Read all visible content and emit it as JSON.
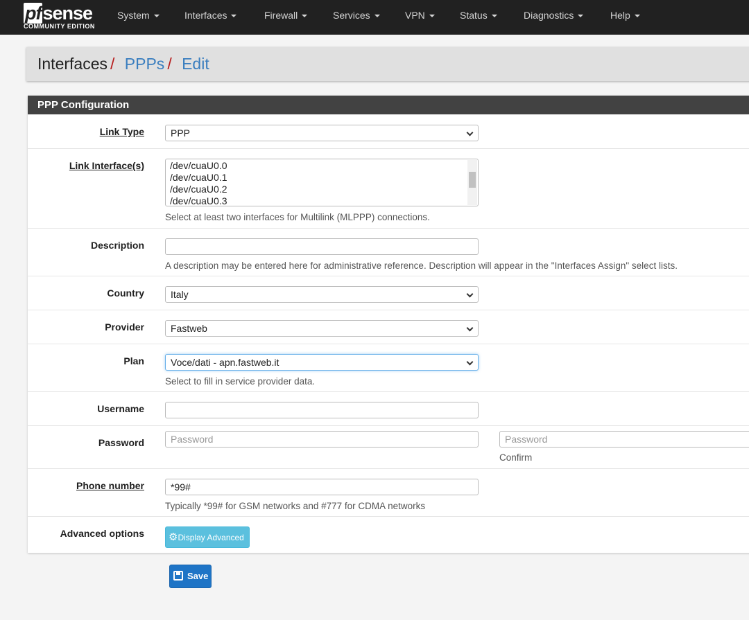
{
  "nav": {
    "logo_main": "pfsense",
    "logo_sub": "COMMUNITY EDITION",
    "items": [
      "System",
      "Interfaces",
      "Firewall",
      "Services",
      "VPN",
      "Status",
      "Diagnostics",
      "Help"
    ]
  },
  "breadcrumb": [
    "Interfaces",
    "PPPs",
    "Edit"
  ],
  "panel_title": "PPP Configuration",
  "form": {
    "link_type": {
      "label": "Link Type",
      "value": "PPP"
    },
    "link_interfaces": {
      "label": "Link Interface(s)",
      "options": [
        "/dev/cuaU0.0",
        "/dev/cuaU0.1",
        "/dev/cuaU0.2",
        "/dev/cuaU0.3"
      ],
      "help": "Select at least two interfaces for Multilink (MLPPP) connections."
    },
    "description": {
      "label": "Description",
      "value": "",
      "help": "A description may be entered here for administrative reference. Description will appear in the \"Interfaces Assign\" select lists."
    },
    "country": {
      "label": "Country",
      "value": "Italy"
    },
    "provider": {
      "label": "Provider",
      "value": "Fastweb"
    },
    "plan": {
      "label": "Plan",
      "value": "Voce/dati - apn.fastweb.it",
      "help": "Select to fill in service provider data."
    },
    "username": {
      "label": "Username",
      "value": ""
    },
    "password": {
      "label": "Password",
      "placeholder": "Password",
      "confirm_placeholder": "Password",
      "confirm_help": "Confirm"
    },
    "phone": {
      "label": "Phone number",
      "value": "*99#",
      "help": "Typically *99# for GSM networks and #777 for CDMA networks"
    },
    "advanced": {
      "label": "Advanced options",
      "button": "Display Advanced"
    }
  },
  "save_label": "Save",
  "colors": {
    "navbar": "#212121",
    "panel_header": "#424242",
    "info_button": "#5bc0de",
    "primary_button": "#1e74c6",
    "link": "#3a7ebf",
    "separator": "#b71c1c"
  }
}
